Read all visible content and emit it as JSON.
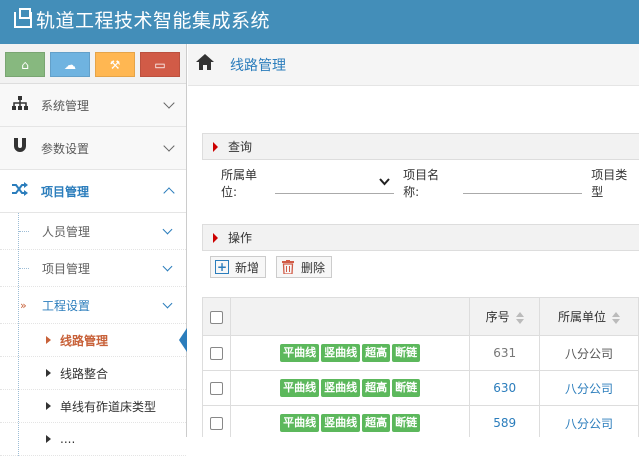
{
  "app": {
    "title": "轨道工程技术智能集成系统"
  },
  "shortcuts": [
    {
      "name": "home",
      "icon": "⌂",
      "color": "green"
    },
    {
      "name": "cloud",
      "icon": "☁",
      "color": "blue"
    },
    {
      "name": "hammer",
      "icon": "⚒",
      "color": "orange"
    },
    {
      "name": "monitor",
      "icon": "▭",
      "color": "red"
    }
  ],
  "sidebar": {
    "items": [
      {
        "label": "系统管理",
        "icon": "sitemap-icon"
      },
      {
        "label": "参数设置",
        "icon": "magnet-icon"
      },
      {
        "label": "项目管理",
        "icon": "random-icon"
      }
    ],
    "project_sub": [
      {
        "label": "人员管理"
      },
      {
        "label": "项目管理"
      },
      {
        "label": "工程设置"
      }
    ],
    "engineering_sub": [
      {
        "label": "线路管理"
      },
      {
        "label": "线路整合"
      },
      {
        "label": "单线有砟道床类型"
      },
      {
        "label": "...."
      }
    ]
  },
  "breadcrumb": {
    "current": "线路管理"
  },
  "query": {
    "title": "查询",
    "unit_label": "所属单位:",
    "project_name_label": "项目名称:",
    "project_type_label": "项目类型"
  },
  "ops": {
    "title": "操作",
    "add_label": "新增",
    "delete_label": "删除"
  },
  "table": {
    "headers": {
      "seq": "序号",
      "unit": "所属单位"
    },
    "tag_labels": [
      "平曲线",
      "竖曲线",
      "超高",
      "断链"
    ],
    "rows": [
      {
        "seq": "631",
        "unit": "八分公司"
      },
      {
        "seq": "630",
        "unit": "八分公司"
      },
      {
        "seq": "589",
        "unit": "八分公司"
      }
    ]
  }
}
